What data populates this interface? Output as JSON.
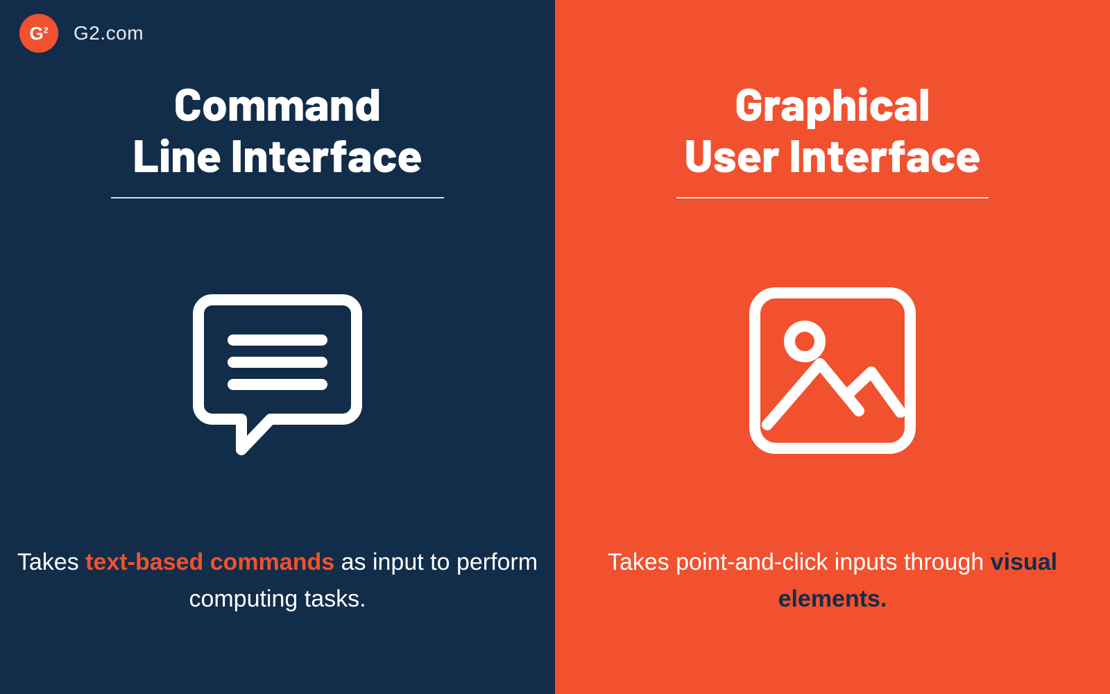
{
  "brand": {
    "badge_text": "G",
    "badge_sup": "2",
    "label": "G2.com"
  },
  "left": {
    "title_line1": "Command",
    "title_line2": "Line Interface",
    "desc_pre": "Takes ",
    "desc_em": "text-based commands",
    "desc_post": " as input to perform computing tasks."
  },
  "right": {
    "title_line1": "Graphical",
    "title_line2": "User Interface",
    "desc_pre": "Takes point-and-click inputs through ",
    "desc_em": "visual elements.",
    "desc_post": ""
  },
  "colors": {
    "navy": "#122D4A",
    "orange": "#F1512F",
    "white": "#FFFFFF"
  }
}
